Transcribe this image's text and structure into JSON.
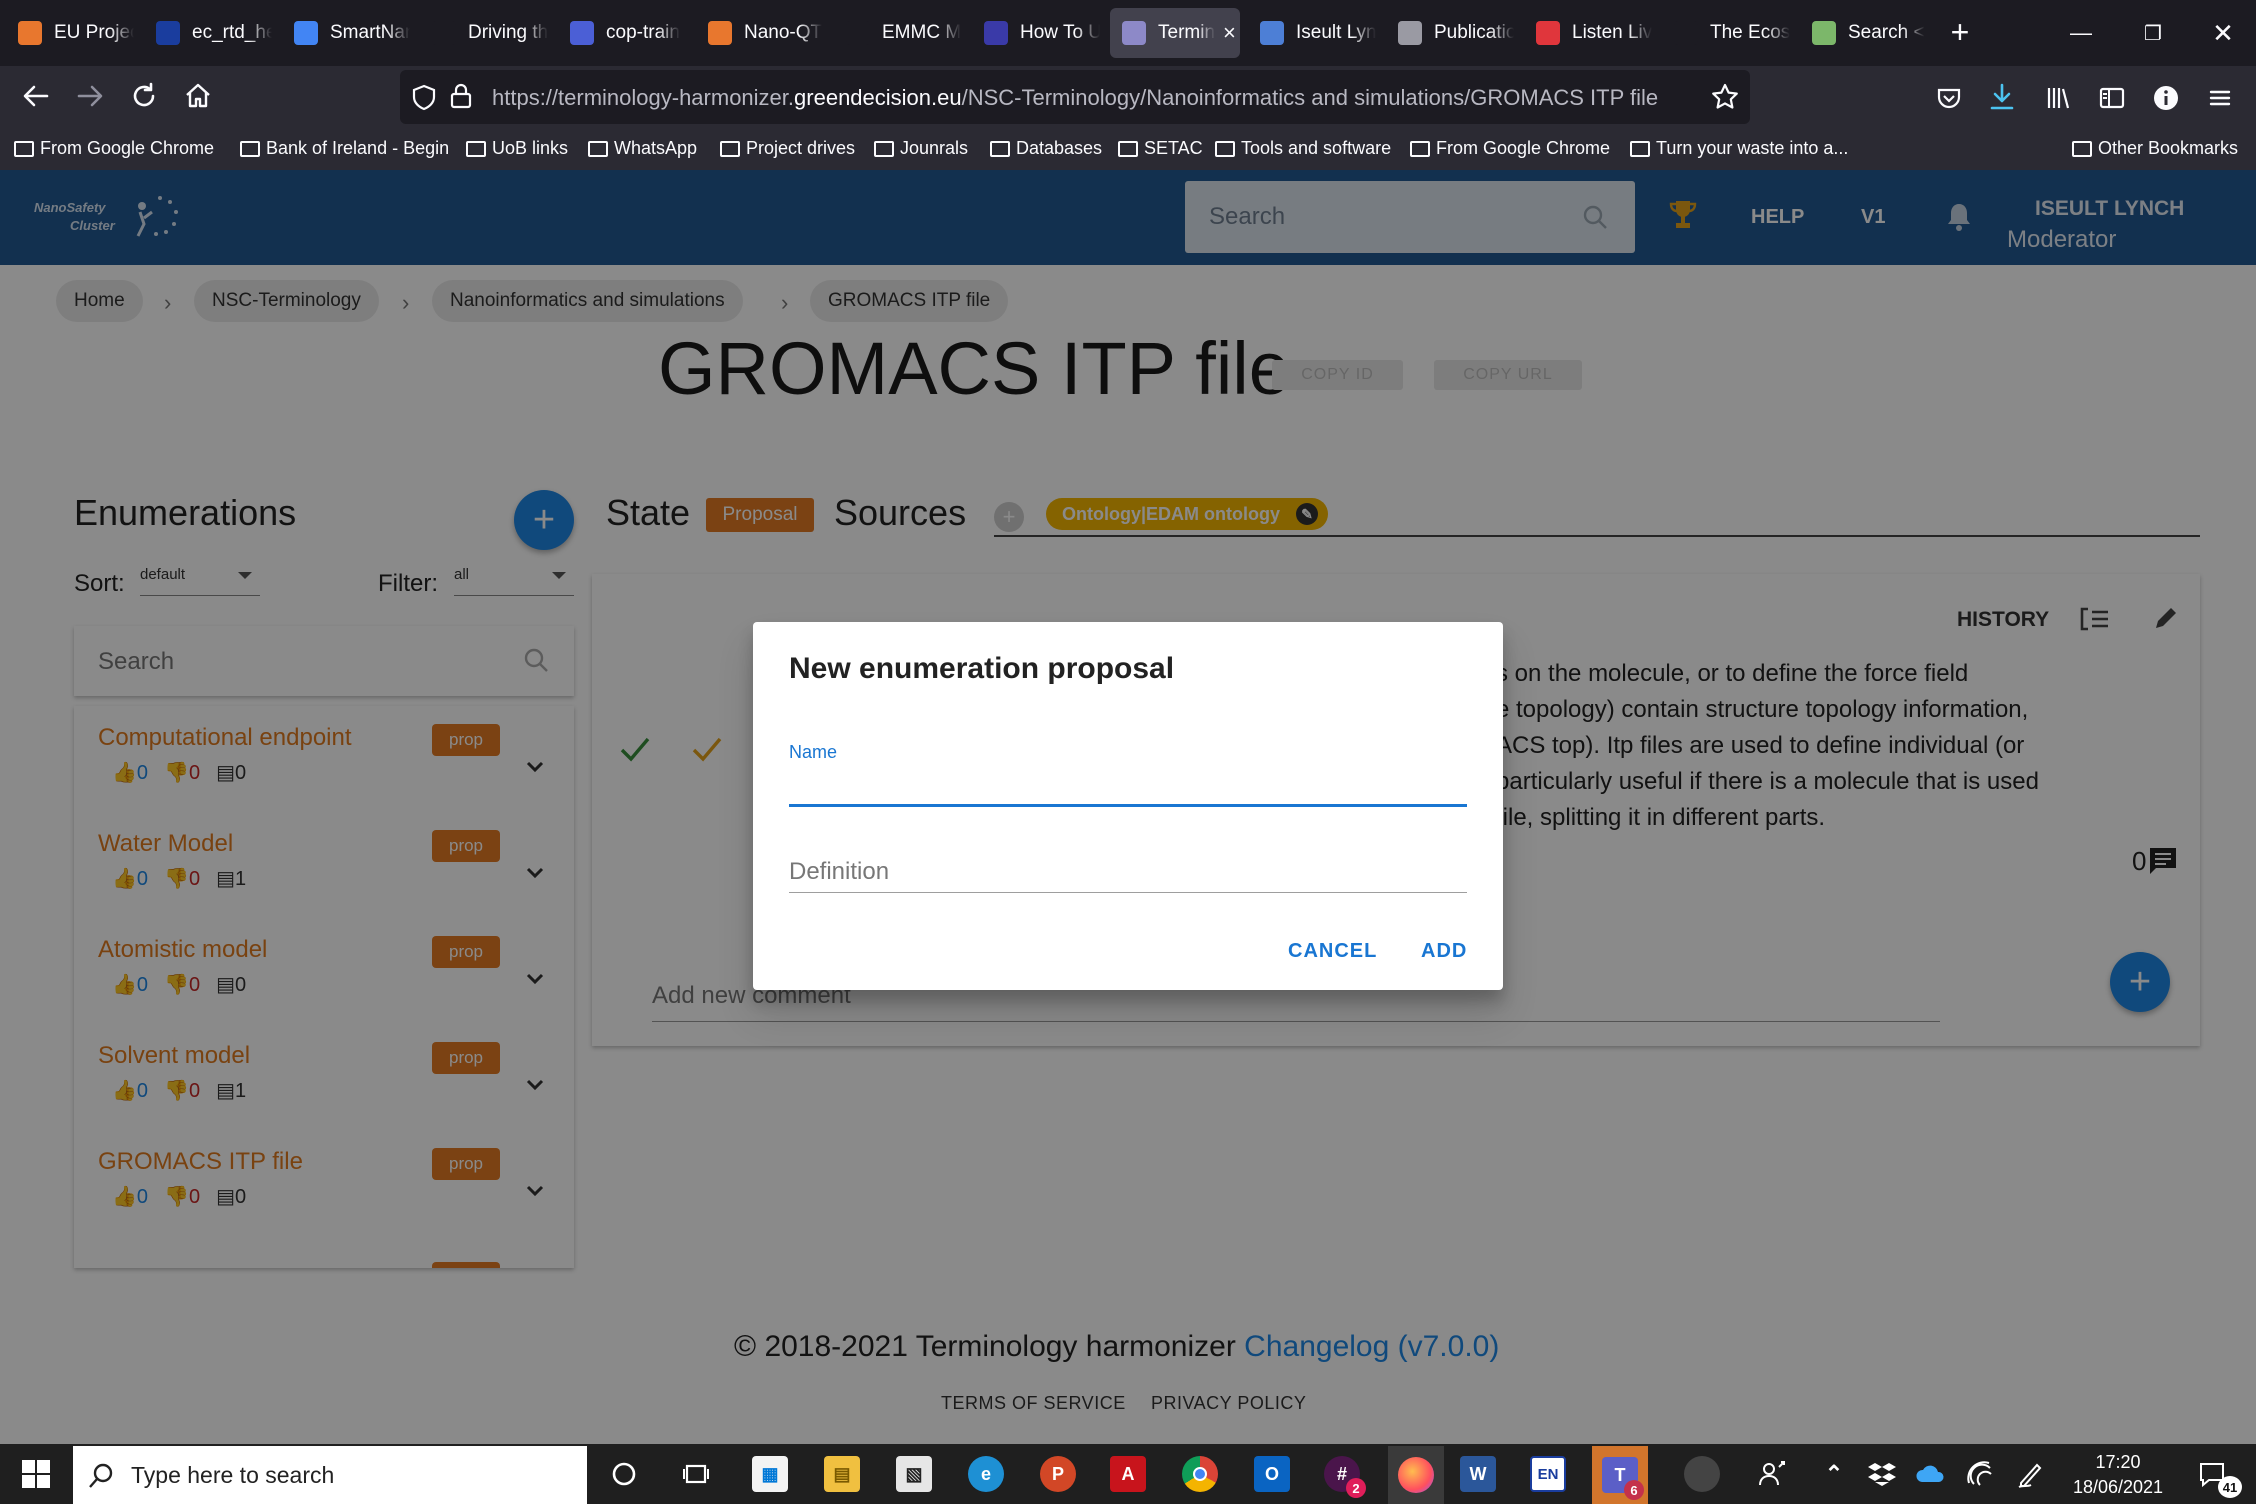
{
  "browser": {
    "tabs": [
      {
        "label": "EU Projec",
        "icon": "feather-icon",
        "color": "#e8772e"
      },
      {
        "label": "ec_rtd_he",
        "icon": "eu-flag-icon",
        "color": "#1a3d9e"
      },
      {
        "label": "SmartNan",
        "icon": "docs-icon",
        "color": "#4285f4"
      },
      {
        "label": "Driving the p",
        "icon": "",
        "color": "#1c1b22"
      },
      {
        "label": "cop-train",
        "icon": "circle-logo-icon",
        "color": "#4b5fd6"
      },
      {
        "label": "Nano-QT",
        "icon": "letter-e-icon",
        "color": "#e8772e"
      },
      {
        "label": "EMMC M",
        "icon": "",
        "color": "#1c1b22"
      },
      {
        "label": "How To U",
        "icon": "page-icon",
        "color": "#3a3aa8"
      },
      {
        "label": "Termin",
        "icon": "hexagon-icon",
        "color": "#8d89c8",
        "active": true
      },
      {
        "label": "Iseult Lyn",
        "icon": "diamond-icon",
        "color": "#4d7fd6"
      },
      {
        "label": "Publicatio",
        "icon": "bars-icon",
        "color": "#9a9aa3"
      },
      {
        "label": "Listen Liv",
        "icon": "star-icon",
        "color": "#e0363c"
      },
      {
        "label": "The Ecosy",
        "icon": "ncbo-icon",
        "color": "#1c1b22"
      },
      {
        "label": "Search <",
        "icon": "search-tab-icon",
        "color": "#7cb76a"
      }
    ],
    "new_tab": "+",
    "url_prefix": "https://terminology-harmonizer.",
    "url_domain": "greendecision.eu",
    "url_path": "/NSC-Terminology/Nanoinformatics and simulations/GROMACS ITP file",
    "bookmarks": [
      "From Google Chrome",
      "Bank of Ireland - Begin",
      "UoB links",
      "WhatsApp",
      "Project drives",
      "Jounrals",
      "Databases",
      "SETAC",
      "Tools and software",
      "From Google Chrome",
      "Turn your waste into a..."
    ],
    "other_bookmarks": "Other Bookmarks"
  },
  "app": {
    "logo_line1": "NanoSafety",
    "logo_line2": "Cluster",
    "search_placeholder": "Search",
    "help": "HELP",
    "version": "V1",
    "user_name": "ISEULT LYNCH",
    "user_role": "Moderator",
    "colors": {
      "header": "#225a93",
      "accent": "#1e88e5",
      "prop": "#e37b23",
      "link": "#e07a1f"
    }
  },
  "breadcrumb": [
    "Home",
    "NSC-Terminology",
    "Nanoinformatics and simulations",
    "GROMACS ITP file"
  ],
  "page": {
    "title": "GROMACS ITP file",
    "copy_id": "COPY ID",
    "copy_url": "COPY URL"
  },
  "enumerations": {
    "heading": "Enumerations",
    "sort_label": "Sort:",
    "sort_value": "default",
    "filter_label": "Filter:",
    "filter_value": "all",
    "search_placeholder": "Search",
    "items": [
      {
        "name": "Computational endpoint",
        "badge": "prop",
        "up": "0",
        "down": "0",
        "comments": "0"
      },
      {
        "name": "Water Model",
        "badge": "prop",
        "up": "0",
        "down": "0",
        "comments": "1"
      },
      {
        "name": "Atomistic model",
        "badge": "prop",
        "up": "0",
        "down": "0",
        "comments": "0"
      },
      {
        "name": "Solvent model",
        "badge": "prop",
        "up": "0",
        "down": "0",
        "comments": "1"
      },
      {
        "name": "GROMACS ITP file",
        "badge": "prop",
        "up": "0",
        "down": "0",
        "comments": "0"
      }
    ]
  },
  "detail": {
    "state_label": "State",
    "state_value": "Proposal",
    "sources_label": "Sources",
    "source_chip": "Ontology|EDAM ontology",
    "history": "HISTORY",
    "definition_lines": [
      "s on the molecule, or to define the force field",
      "e topology) contain structure topology information,",
      "ACS top). Itp files are used to define individual (or",
      "particularly useful if there is a molecule that is used",
      "file, splitting it in different parts."
    ],
    "comment_count": "0",
    "add_comment_placeholder": "Add new comment"
  },
  "footer": {
    "copyright": "© 2018-2021 Terminology harmonizer",
    "changelog": "Changelog (v7.0.0)",
    "terms": "TERMS OF SERVICE",
    "privacy": "PRIVACY POLICY"
  },
  "dialog": {
    "title": "New enumeration proposal",
    "name_label": "Name",
    "name_value": "",
    "definition_placeholder": "Definition",
    "cancel": "CANCEL",
    "add": "ADD"
  },
  "taskbar": {
    "search_placeholder": "Type here to search",
    "time": "17:20",
    "date": "18/06/2021",
    "notification_count": "41",
    "slack_badge": "2",
    "teams_badge": "6"
  }
}
